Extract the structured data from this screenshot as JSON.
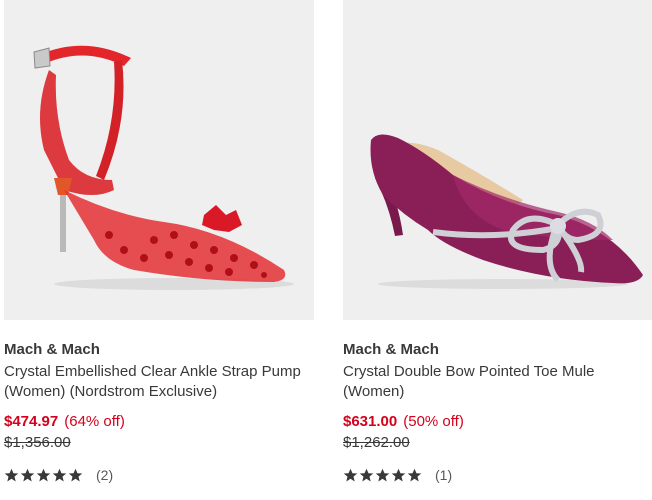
{
  "products": [
    {
      "brand": "Mach & Mach",
      "title": "Crystal Embellished Clear Ankle Strap Pump (Women) (Nordstrom Exclusive)",
      "sale_price": "$474.97",
      "discount": "(64% off)",
      "original_price": "$1,356.00",
      "rating": 5,
      "review_count": "(2)",
      "image_icon": "red-crystal-pump-image",
      "shoe_color": "#d8262a"
    },
    {
      "brand": "Mach & Mach",
      "title": "Crystal Double Bow Pointed Toe Mule (Women)",
      "sale_price": "$631.00",
      "discount": "(50% off)",
      "original_price": "$1,262.00",
      "rating": 5,
      "review_count": "(1)",
      "image_icon": "purple-bow-mule-image",
      "shoe_color": "#8a1f57"
    }
  ],
  "colors": {
    "sale_red": "#d6001c",
    "text": "#393939",
    "image_bg": "#efefef"
  }
}
